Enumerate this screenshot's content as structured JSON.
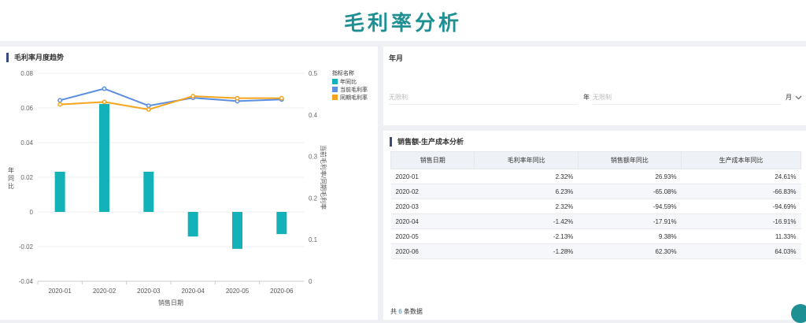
{
  "header": {
    "title": "毛利率分析"
  },
  "chart_panel": {
    "title": "毛利率月度趋势"
  },
  "chart_data": {
    "type": "bar",
    "title": "毛利率月度趋势",
    "categories": [
      "2020-01",
      "2020-02",
      "2020-03",
      "2020-04",
      "2020-05",
      "2020-06"
    ],
    "xlabel": "销售日期",
    "ylabel_left": "年同比",
    "ylabel_right": "当前毛利率/同期毛利率",
    "ylim_left": [
      -0.04,
      0.08
    ],
    "yticks_left": [
      "0.08",
      "0.06",
      "0.04",
      "0.02",
      "0",
      "-0.02",
      "-0.04"
    ],
    "ylim_right": [
      0,
      0.5
    ],
    "yticks_right": [
      "0.5",
      "0.4",
      "0.3",
      "0.2",
      "0.1",
      "0"
    ],
    "legend_title": "指标名称",
    "legend_position": "top-right",
    "series": [
      {
        "name": "年同比",
        "type": "bar",
        "axis": "left",
        "color": "#13b2b8",
        "values": [
          0.0232,
          0.0623,
          0.0232,
          -0.0142,
          -0.0213,
          -0.0128
        ]
      },
      {
        "name": "当前毛利率",
        "type": "line",
        "axis": "right",
        "color": "#5b8fe0",
        "values": [
          0.435,
          0.463,
          0.422,
          0.441,
          0.433,
          0.437
        ]
      },
      {
        "name": "同期毛利率",
        "type": "line",
        "axis": "right",
        "color": "#f5a51d",
        "values": [
          0.425,
          0.431,
          0.413,
          0.445,
          0.44,
          0.44
        ]
      }
    ]
  },
  "filter": {
    "label": "年月",
    "start_placeholder": "无限制",
    "end_placeholder": "无限制",
    "unit_start": "年",
    "unit_end": "月"
  },
  "table_panel": {
    "title": "销售额-生产成本分析",
    "columns": [
      "销售日期",
      "毛利率年同比",
      "销售额年同比",
      "生产成本年同比"
    ],
    "rows": [
      [
        "2020-01",
        "2.32%",
        "26.93%",
        "24.61%"
      ],
      [
        "2020-02",
        "6.23%",
        "-65.08%",
        "-66.83%"
      ],
      [
        "2020-03",
        "2.32%",
        "-94.59%",
        "-94.69%"
      ],
      [
        "2020-04",
        "-1.42%",
        "-17.91%",
        "-16.91%"
      ],
      [
        "2020-05",
        "-2.13%",
        "9.38%",
        "11.33%"
      ],
      [
        "2020-06",
        "-1.28%",
        "62.30%",
        "64.03%"
      ]
    ],
    "footer_prefix": "共",
    "footer_count": "6",
    "footer_suffix": "条数据"
  }
}
